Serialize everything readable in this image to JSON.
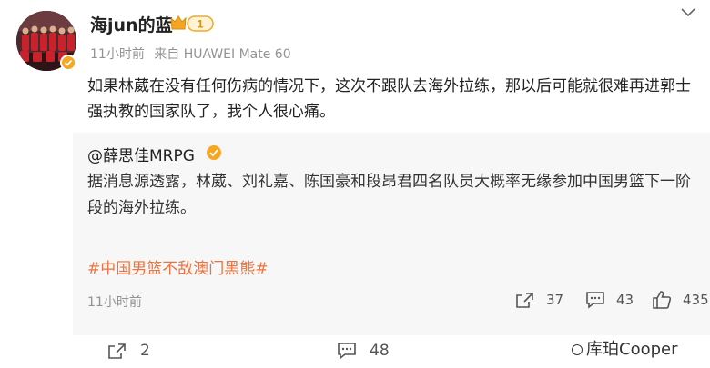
{
  "post": {
    "username": "海jun的蓝",
    "vip_level": "1",
    "time": "11小时前",
    "source": "来自 HUAWEI Mate 60",
    "text": "如果林葳在没有任何伤病的情况下，这次不跟队去海外拉练，那以后可能就很难再进郭士强执教的国家队了，我个人很心痛。"
  },
  "repost": {
    "author": "@薛思佳MRPG",
    "text": "据消息源透露，林葳、刘礼嘉、陈国豪和段昂君四名队员大概率无缘参加中国男篮下一阶段的海外拉练。",
    "hashtag": "#中国男篮不敌澳门黑熊#",
    "time": "11小时前",
    "shares": "37",
    "comments": "43",
    "likes": "435"
  },
  "footer": {
    "shares": "2",
    "comments": "48"
  },
  "watermark": "库珀Cooper",
  "colors": {
    "hashtag": "#eb7340",
    "badge": "#f5a623",
    "muted": "#939393"
  }
}
